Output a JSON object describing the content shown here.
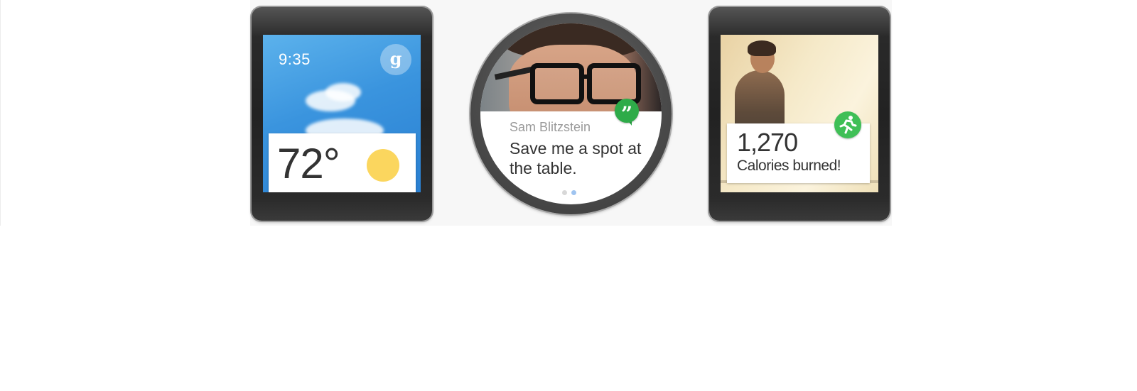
{
  "weather_watch": {
    "time": "9:35",
    "google_badge": "g",
    "temperature": "72°",
    "icon": "sun-icon"
  },
  "message_watch": {
    "sender": "Sam Blitzstein",
    "message": "Save me a spot at the table.",
    "app_icon": "hangouts-icon",
    "page_count": 2,
    "active_page": 2
  },
  "fitness_watch": {
    "calories_value": "1,270",
    "calories_label": "Calories burned!",
    "app_icon": "running-person-icon"
  },
  "colors": {
    "sun": "#fbd65e",
    "hangouts_green": "#2eab49",
    "fit_green": "#3fbf56",
    "sky_blue": "#3a94de"
  }
}
